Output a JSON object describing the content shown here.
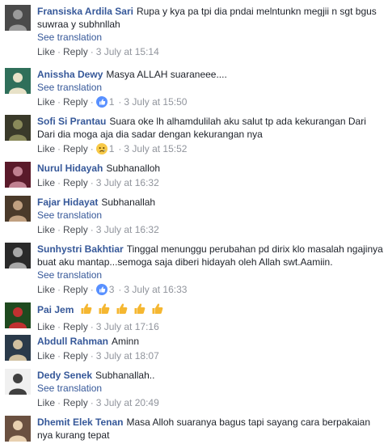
{
  "actions": {
    "like": "Like",
    "reply": "Reply",
    "see_translation": "See translation",
    "separator": "·"
  },
  "comments": [
    {
      "author": "Fransiska Ardila Sari",
      "text": "Rupa y kya pa tpi dia pndai melntunkn megjii n sgt bgus suwraa y subhnllah",
      "see_translation": true,
      "reaction": null,
      "reaction_count": "",
      "time": "3 July at 15:14",
      "avatar": "avatar-icon"
    },
    {
      "author": "Anissha Dewy",
      "text": "Masya ALLAH suaraneee....",
      "see_translation": true,
      "reaction": "like",
      "reaction_count": "1",
      "time": "3 July at 15:50",
      "avatar": "avatar-icon"
    },
    {
      "author": "Sofi Si Prantau",
      "text": "Suara oke lh alhamdulilah aku salut tp ada kekurangan Dari Dari dia moga aja dia sadar dengan kekurangan nya",
      "see_translation": false,
      "reaction": "sad",
      "reaction_count": "1",
      "time": "3 July at 15:52",
      "avatar": "avatar-icon"
    },
    {
      "author": "Nurul Hidayah",
      "text": "Subhanalloh",
      "see_translation": false,
      "reaction": null,
      "reaction_count": "",
      "time": "3 July at 16:32",
      "avatar": "avatar-icon"
    },
    {
      "author": "Fajar Hidayat",
      "text": "Subhanallah",
      "see_translation": true,
      "reaction": null,
      "reaction_count": "",
      "time": "3 July at 16:32",
      "avatar": "avatar-icon"
    },
    {
      "author": "Sunhystri Bakhtiar",
      "text": "Tinggal menunggu perubahan pd dirix klo masalah ngajinya buat aku mantap...semoga saja diberi hidayah oleh Allah swt.Aamiin.",
      "see_translation": true,
      "reaction": "like",
      "reaction_count": "3",
      "time": "3 July at 16:33",
      "avatar": "avatar-icon"
    },
    {
      "author": "Pai Jem",
      "text": "",
      "thumbs": 5,
      "see_translation": false,
      "reaction": null,
      "reaction_count": "",
      "time": "3 July at 17:16",
      "avatar": "avatar-icon"
    },
    {
      "author": "Abdull Rahman",
      "text": "Aminn",
      "see_translation": false,
      "reaction": null,
      "reaction_count": "",
      "time": "3 July at 18:07",
      "avatar": "avatar-icon"
    },
    {
      "author": "Dedy Senek",
      "text": "Subhanallah..",
      "see_translation": true,
      "reaction": null,
      "reaction_count": "",
      "time": "3 July at 20:49",
      "avatar": "avatar-icon"
    },
    {
      "author": "Dhemit Elek Tenan",
      "text": "Masa Alloh suaranya bagus tapi sayang cara berpakaian nya kurang tepat",
      "see_translation": false,
      "reaction": null,
      "reaction_count": "",
      "time": "",
      "avatar": "avatar-icon"
    }
  ]
}
